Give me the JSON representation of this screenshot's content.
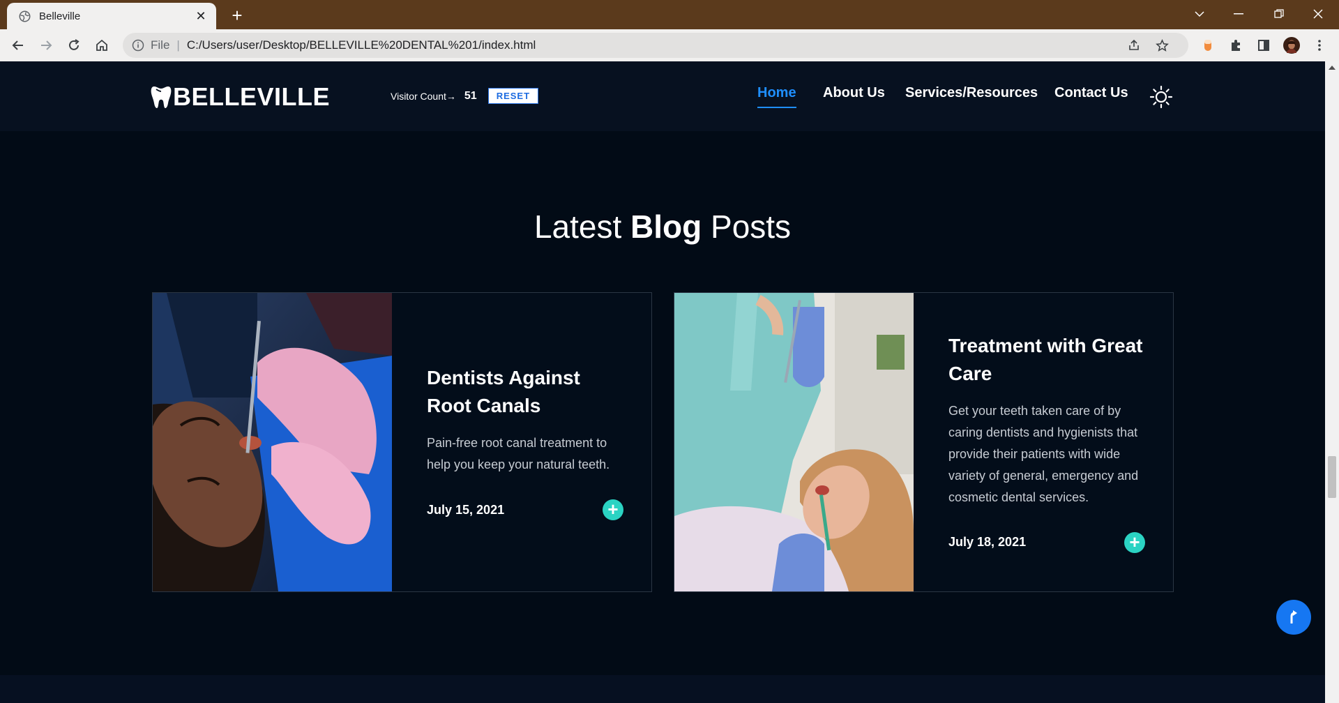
{
  "browser": {
    "tab_title": "Belleville",
    "new_tab": "+",
    "url_scheme_label": "File",
    "url": "C:/Users/user/Desktop/BELLEVILLE%20DENTAL%201/index.html",
    "window_controls": [
      "chevron-down-icon",
      "minimize-icon",
      "restore-icon",
      "close-icon"
    ],
    "toolbar_icons": [
      "back-arrow-icon",
      "forward-arrow-icon",
      "reload-icon",
      "home-icon"
    ],
    "right_icons": [
      "share-icon",
      "star-icon",
      "extension-orange-icon",
      "puzzle-icon",
      "sidebar-icon",
      "profile-avatar",
      "menu-dots-icon"
    ]
  },
  "header": {
    "logo_text": "BELLEVILLE",
    "visitor_label": "Visitor Count→",
    "visitor_count": "51",
    "reset_label": "RESET",
    "nav": [
      {
        "label": "Home",
        "active": true
      },
      {
        "label": "About Us",
        "active": false
      },
      {
        "label": "Services/Resources",
        "active": false
      },
      {
        "label": "Contact Us",
        "active": false
      }
    ],
    "theme_icon": "sun-icon"
  },
  "blog": {
    "title_pre": "Latest",
    "title_bold": "Blog",
    "title_post": "Posts",
    "posts": [
      {
        "title": "Dentists Against Root Canals",
        "excerpt": "Pain-free root canal treatment to help you keep your natural teeth.",
        "date": "July 15, 2021",
        "action": "+"
      },
      {
        "title": "Treatment with Great Care",
        "excerpt": "Get your teeth taken care of by caring dentists and hygienists that provide their patients with wide variety of general, emergency and cosmetic dental services.",
        "date": "July 18, 2021",
        "action": "+"
      }
    ]
  },
  "back_to_top_icon": "arrow-up-icon",
  "colors": {
    "page_bg": "#020b16",
    "header_bg": "#071120",
    "accent_blue": "#1f8fff",
    "plus_teal": "#2bd3c3",
    "browser_frame": "#5b3a1c"
  }
}
